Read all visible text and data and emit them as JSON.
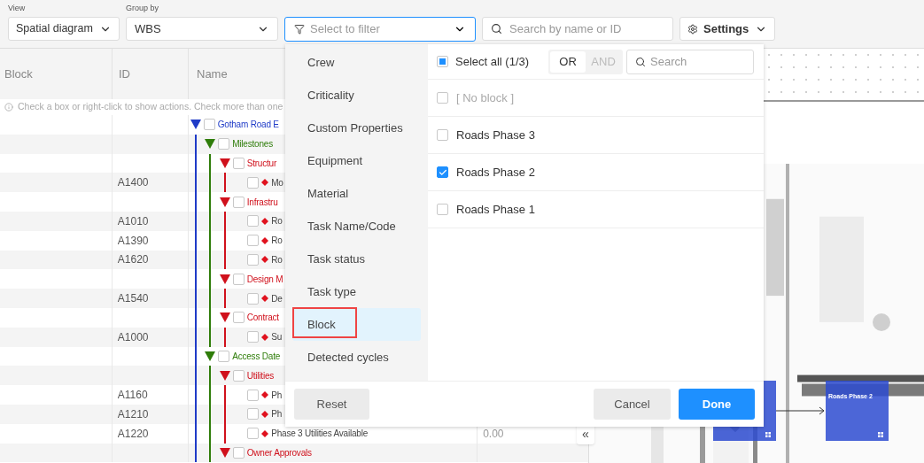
{
  "toolbar": {
    "view": {
      "label": "View",
      "value": "Spatial diagram"
    },
    "group_by": {
      "label": "Group by",
      "value": "WBS"
    },
    "filter": {
      "placeholder": "Select to filter"
    },
    "search": {
      "placeholder": "Search by name or ID"
    },
    "settings": {
      "label": "Settings"
    }
  },
  "table": {
    "columns": [
      "Block",
      "ID",
      "Name"
    ],
    "hint": "Check a box or right-click to show actions. Check more than one",
    "tree": [
      {
        "kind": "group",
        "name": "Gotham Road E",
        "color": "#1f3bc7",
        "expanded": true,
        "checked": false,
        "children": [
          {
            "kind": "group",
            "name": "Milestones",
            "color": "#2f7d0a",
            "expanded": true,
            "checked": false,
            "children": [
              {
                "kind": "group",
                "name": "Structur",
                "color": "#d0111c",
                "expanded": true,
                "checked": false,
                "children": [
                  {
                    "kind": "task",
                    "id": "A1400",
                    "name": "Mo",
                    "checked": false
                  }
                ]
              },
              {
                "kind": "group",
                "name": "Infrastru",
                "color": "#d0111c",
                "expanded": true,
                "checked": false,
                "children": [
                  {
                    "kind": "task",
                    "id": "A1010",
                    "name": "Ro",
                    "checked": false
                  },
                  {
                    "kind": "task",
                    "id": "A1390",
                    "name": "Ro",
                    "checked": false
                  },
                  {
                    "kind": "task",
                    "id": "A1620",
                    "name": "Ro",
                    "checked": false
                  }
                ]
              },
              {
                "kind": "group",
                "name": "Design M",
                "color": "#d0111c",
                "expanded": true,
                "checked": false,
                "children": [
                  {
                    "kind": "task",
                    "id": "A1540",
                    "name": "De",
                    "checked": false
                  }
                ]
              },
              {
                "kind": "group",
                "name": "Contract",
                "color": "#d0111c",
                "expanded": true,
                "checked": false,
                "children": [
                  {
                    "kind": "task",
                    "id": "A1000",
                    "name": "Su",
                    "checked": false
                  }
                ]
              }
            ]
          },
          {
            "kind": "group",
            "name": "Access Date",
            "color": "#2f7d0a",
            "expanded": true,
            "checked": false,
            "children": [
              {
                "kind": "group",
                "name": "Utilities",
                "color": "#d0111c",
                "expanded": true,
                "checked": false,
                "children": [
                  {
                    "kind": "task",
                    "id": "A1160",
                    "name": "Ph",
                    "checked": false
                  },
                  {
                    "kind": "task",
                    "id": "A1210",
                    "name": "Ph",
                    "checked": false
                  },
                  {
                    "kind": "task",
                    "id": "A1220",
                    "name": "Phase 3 Utilities Available",
                    "value": "0.00",
                    "checked": false
                  }
                ]
              },
              {
                "kind": "group",
                "name": "Owner Approvals",
                "color": "#d0111c",
                "expanded": true,
                "checked": false
              }
            ]
          }
        ]
      }
    ]
  },
  "filter_popup": {
    "categories": [
      {
        "label": "Crew",
        "selected": false
      },
      {
        "label": "Criticality",
        "selected": false
      },
      {
        "label": "Custom Properties",
        "selected": false
      },
      {
        "label": "Equipment",
        "selected": false
      },
      {
        "label": "Material",
        "selected": false
      },
      {
        "label": "Task Name/Code",
        "selected": false
      },
      {
        "label": "Task status",
        "selected": false
      },
      {
        "label": "Task type",
        "selected": false
      },
      {
        "label": "Block",
        "selected": true,
        "annotated": true
      },
      {
        "label": "Detected cycles",
        "selected": false
      }
    ],
    "select_all": {
      "label": "Select all (1/3)",
      "indeterminate": true
    },
    "logic": [
      {
        "label": "OR",
        "selected": true
      },
      {
        "label": "AND",
        "selected": false
      }
    ],
    "search": {
      "placeholder": "Search"
    },
    "options": [
      {
        "label": "[ No block ]",
        "checked": false,
        "disabled": true
      },
      {
        "label": "Roads Phase 3",
        "checked": false,
        "disabled": false
      },
      {
        "label": "Roads Phase 2",
        "checked": true,
        "disabled": false
      },
      {
        "label": "Roads Phase 1",
        "checked": false,
        "disabled": false
      }
    ],
    "buttons": [
      {
        "kind": "reset",
        "label": "Reset"
      },
      {
        "kind": "cancel",
        "label": "Cancel"
      },
      {
        "kind": "done",
        "label": "Done"
      }
    ]
  },
  "collapse_button": {
    "label": "«"
  },
  "canvas": {
    "blocks": [
      {
        "kind": "block"
      },
      {
        "kind": "block",
        "label": "Roads Phase 2"
      }
    ]
  }
}
